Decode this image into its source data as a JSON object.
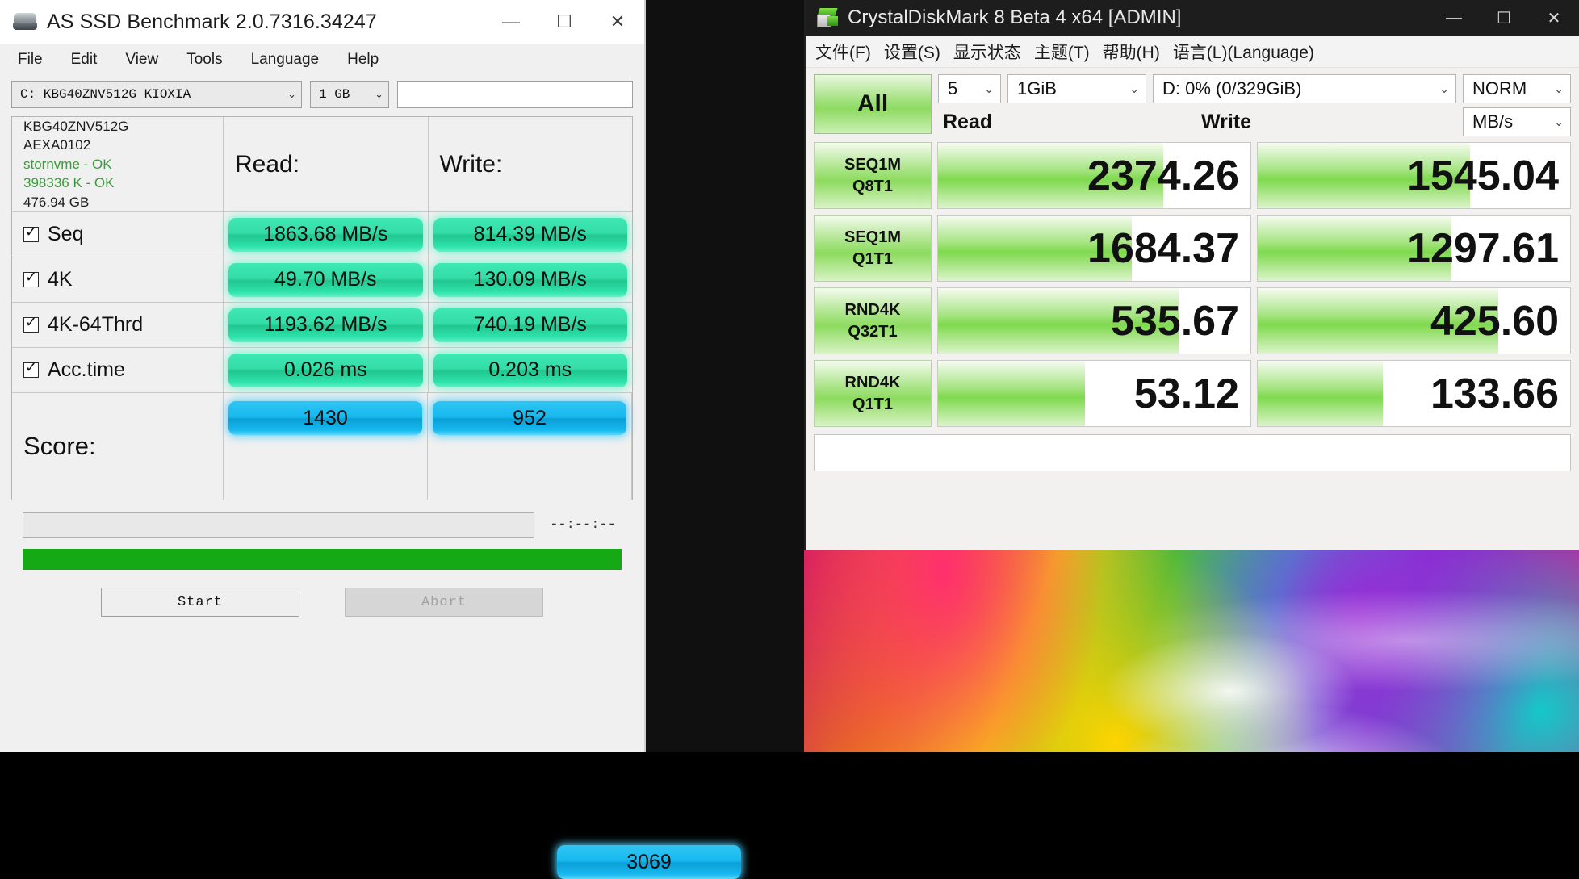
{
  "asssd": {
    "title": "AS SSD Benchmark 2.0.7316.34247",
    "window_buttons": {
      "minimize": "—",
      "maximize": "☐",
      "close": "✕"
    },
    "menu": [
      "File",
      "Edit",
      "View",
      "Tools",
      "Language",
      "Help"
    ],
    "drive_combo": "C: KBG40ZNV512G KIOXIA",
    "size_combo": "1 GB",
    "name_field_value": "",
    "info": {
      "model": "KBG40ZNV512G",
      "firmware": "AEXA0102",
      "driver": "stornvme - OK",
      "alignment": "398336 K - OK",
      "capacity": "476.94 GB"
    },
    "col_read": "Read:",
    "col_write": "Write:",
    "rows": [
      {
        "label": "Seq",
        "read": "1863.68 MB/s",
        "write": "814.39 MB/s",
        "checked": true
      },
      {
        "label": "4K",
        "read": "49.70 MB/s",
        "write": "130.09 MB/s",
        "checked": true
      },
      {
        "label": "4K-64Thrd",
        "read": "1193.62 MB/s",
        "write": "740.19 MB/s",
        "checked": true
      },
      {
        "label": "Acc.time",
        "read": "0.026 ms",
        "write": "0.203 ms",
        "checked": true
      }
    ],
    "score_label": "Score:",
    "score_read": "1430",
    "score_write": "952",
    "score_total": "3069",
    "elapsed_time": "--:--:--",
    "progress_percent": 100,
    "start_button": "Start",
    "abort_button": "Abort"
  },
  "cdm": {
    "title": "CrystalDiskMark 8 Beta 4 x64 [ADMIN]",
    "window_buttons": {
      "minimize": "—",
      "maximize": "☐",
      "close": "✕"
    },
    "menu": [
      "文件(F)",
      "设置(S)",
      "显示状态",
      "主题(T)",
      "帮助(H)",
      "语言(L)(Language)"
    ],
    "all_button": "All",
    "count_combo": "5",
    "size_combo": "1GiB",
    "drive_combo": "D: 0% (0/329GiB)",
    "norm_combo": "NORM",
    "unit_combo": "MB/s",
    "col_read": "Read",
    "col_write": "Write",
    "status_text": "",
    "rows": [
      {
        "name1": "SEQ1M",
        "name2": "Q8T1",
        "read": "2374.26",
        "write": "1545.04",
        "read_bar": 72,
        "write_bar": 68
      },
      {
        "name1": "SEQ1M",
        "name2": "Q1T1",
        "read": "1684.37",
        "write": "1297.61",
        "read_bar": 62,
        "write_bar": 62
      },
      {
        "name1": "RND4K",
        "name2": "Q32T1",
        "read": "535.67",
        "write": "425.60",
        "read_bar": 77,
        "write_bar": 77
      },
      {
        "name1": "RND4K",
        "name2": "Q1T1",
        "read": "53.12",
        "write": "133.66",
        "read_bar": 47,
        "write_bar": 40
      }
    ]
  }
}
